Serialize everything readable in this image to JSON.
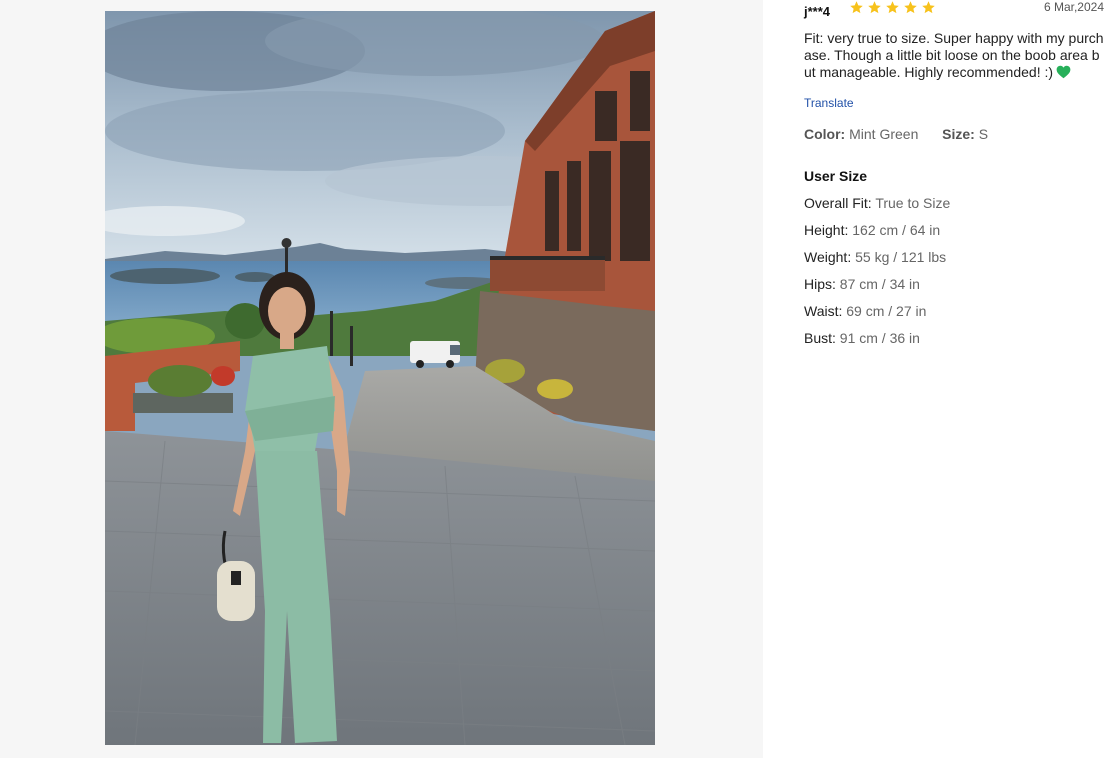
{
  "review": {
    "reviewer": "j***4",
    "rating": 5,
    "date": "6 Mar,2024",
    "text": "Fit: very true to size. Super happy with my purchase. Though a little bit loose on the boob area but manageable. Highly recommended! :)",
    "emoji": "green-heart-icon",
    "translate_label": "Translate",
    "attributes": {
      "color_label": "Color:",
      "color_value": "Mint Green",
      "size_label": "Size:",
      "size_value": "S"
    },
    "user_size": {
      "title": "User Size",
      "items": [
        {
          "label": "Overall Fit:",
          "value": "True to Size"
        },
        {
          "label": "Height:",
          "value": "162 cm / 64 in"
        },
        {
          "label": "Weight:",
          "value": "55 kg / 121 lbs"
        },
        {
          "label": "Hips:",
          "value": "87 cm / 34 in"
        },
        {
          "label": "Waist:",
          "value": "69 cm / 27 in"
        },
        {
          "label": "Bust:",
          "value": "91 cm / 36 in"
        }
      ]
    }
  },
  "colors": {
    "star": "#f7c21c",
    "link": "#2251a8",
    "heart": "#27b05a",
    "panel_bg": "#f6f6f6"
  }
}
